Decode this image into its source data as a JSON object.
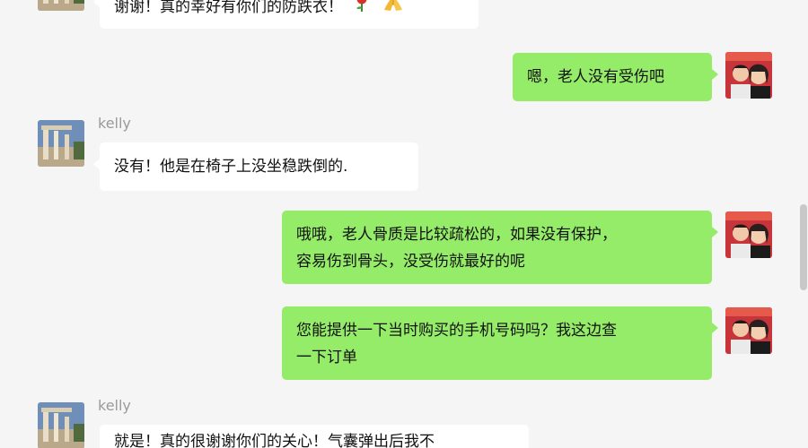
{
  "messages": [
    {
      "side": "in",
      "text": "谢谢！真的幸好有你们的防跌衣！",
      "emojis": [
        "rose-icon",
        "pray-hands-icon"
      ]
    },
    {
      "side": "out",
      "text": "嗯，老人没有受伤吧"
    },
    {
      "side": "in",
      "sender": "kelly",
      "text": "没有！他是在椅子上没坐稳跌倒的."
    },
    {
      "side": "out",
      "lines": [
        "哦哦，老人骨质是比较疏松的，如果没有保护，",
        "容易伤到骨头，没受伤就最好的呢"
      ]
    },
    {
      "side": "out",
      "lines": [
        "您能提供一下当时购买的手机号码吗？我这边查",
        "一下订单"
      ]
    },
    {
      "side": "in",
      "sender": "kelly",
      "text": "就是！真的很谢谢你们的关心！气囊弹出后我不"
    }
  ],
  "colors": {
    "background": "#f5f5f5",
    "incoming_bubble": "#ffffff",
    "outgoing_bubble": "#95ec69",
    "sender_name": "#9a9a9a"
  }
}
